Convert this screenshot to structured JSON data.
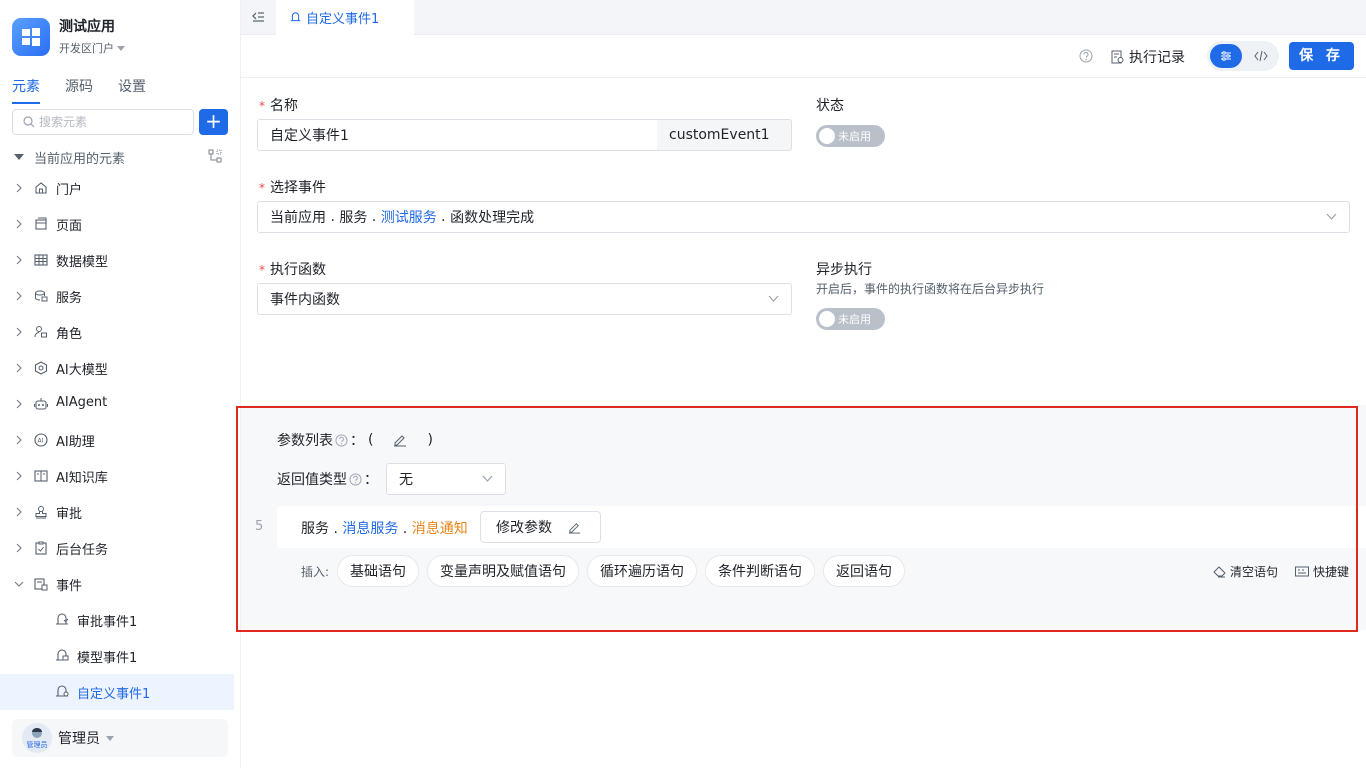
{
  "sidebar": {
    "app_name": "测试应用",
    "portal": "开发区门户",
    "tabs": [
      "元素",
      "源码",
      "设置"
    ],
    "search_placeholder": "搜索元素",
    "add_label": "+",
    "tree_root": "当前应用的元素",
    "items": [
      {
        "label": "门户",
        "icon": "home-icon"
      },
      {
        "label": "页面",
        "icon": "page-icon"
      },
      {
        "label": "数据模型",
        "icon": "table-icon"
      },
      {
        "label": "服务",
        "icon": "service-icon"
      },
      {
        "label": "角色",
        "icon": "role-icon"
      },
      {
        "label": "AI大模型",
        "icon": "ai-model-icon"
      },
      {
        "label": "AIAgent",
        "icon": "robot-icon"
      },
      {
        "label": "AI助理",
        "icon": "ai-assistant-icon"
      },
      {
        "label": "AI知识库",
        "icon": "book-icon"
      },
      {
        "label": "审批",
        "icon": "approval-icon"
      },
      {
        "label": "后台任务",
        "icon": "task-icon"
      },
      {
        "label": "事件",
        "icon": "event-icon"
      }
    ],
    "events": [
      {
        "label": "审批事件1"
      },
      {
        "label": "模型事件1"
      },
      {
        "label": "自定义事件1"
      }
    ],
    "user": {
      "avatar_text": "管理员",
      "name": "管理员"
    }
  },
  "tab": {
    "label": "自定义事件1"
  },
  "toolbar": {
    "exec_log": "执行记录",
    "save": "保 存"
  },
  "form": {
    "name_label": "名称",
    "name_value": "自定义事件1",
    "name_code": "customEvent1",
    "status_label": "状态",
    "status_toggle": "未启用",
    "event_label": "选择事件",
    "event_path": {
      "p1": "当前应用",
      "p2": "服务",
      "p3": "测试服务",
      "p4": "函数处理完成",
      "sep": " . "
    },
    "func_label": "执行函数",
    "func_value": "事件内函数",
    "async_label": "异步执行",
    "async_desc": "开启后，事件的执行函数将在后台异步执行",
    "async_toggle": "未启用"
  },
  "code": {
    "params_label": "参数列表",
    "colon": "：",
    "open_paren": "(",
    "close_paren": ")",
    "ret_label": "返回值类型",
    "ret_value": "无",
    "line_no": "5",
    "stmt": {
      "p1": "服务",
      "p2": "消息服务",
      "p3": "消息通知",
      "sep": " . "
    },
    "modify": "修改参数",
    "insert_label": "插入:",
    "insert_buttons": [
      "基础语句",
      "变量声明及赋值语句",
      "循环遍历语句",
      "条件判断语句",
      "返回语句"
    ],
    "clear": "清空语句",
    "shortcut": "快捷键"
  },
  "colors": {
    "accent": "#1f6ae6",
    "highlight_border": "#e0281e",
    "orange": "#e8861a"
  }
}
